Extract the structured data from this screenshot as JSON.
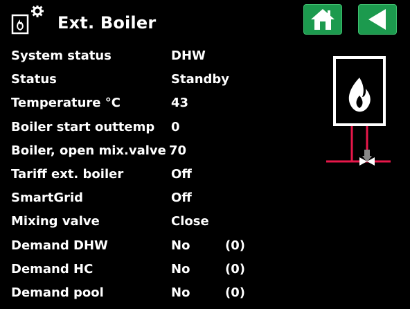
{
  "header": {
    "title": "Ext. Boiler",
    "icon": "boiler-settings-icon",
    "home_icon": "home-icon",
    "back_icon": "back-arrow-icon"
  },
  "rows": [
    {
      "label": "System status",
      "value": "DHW"
    },
    {
      "label": "Status",
      "value": "Standby"
    },
    {
      "label": "Temperature °C",
      "value": "43"
    },
    {
      "label": "Boiler start outtemp",
      "value": "0"
    },
    {
      "label": "Boiler, open mix.valve °",
      "value": "70"
    },
    {
      "label": "Tariff ext. boiler",
      "value": "Off"
    },
    {
      "label": "SmartGrid",
      "value": "Off"
    },
    {
      "label": "Mixing valve",
      "value": "Close"
    },
    {
      "label": "Demand DHW",
      "value": "No",
      "extra": "(0)"
    },
    {
      "label": "Demand HC",
      "value": "No",
      "extra": "(0)"
    },
    {
      "label": "Demand pool",
      "value": "No",
      "extra": "(0)"
    }
  ],
  "colors": {
    "background": "#000000",
    "button_green": "#1c9a4e",
    "pipe_red": "#e8174a",
    "text": "#ffffff"
  },
  "diagram": {
    "icon": "boiler-flame-icon",
    "valve_icon": "mixing-valve-icon"
  }
}
